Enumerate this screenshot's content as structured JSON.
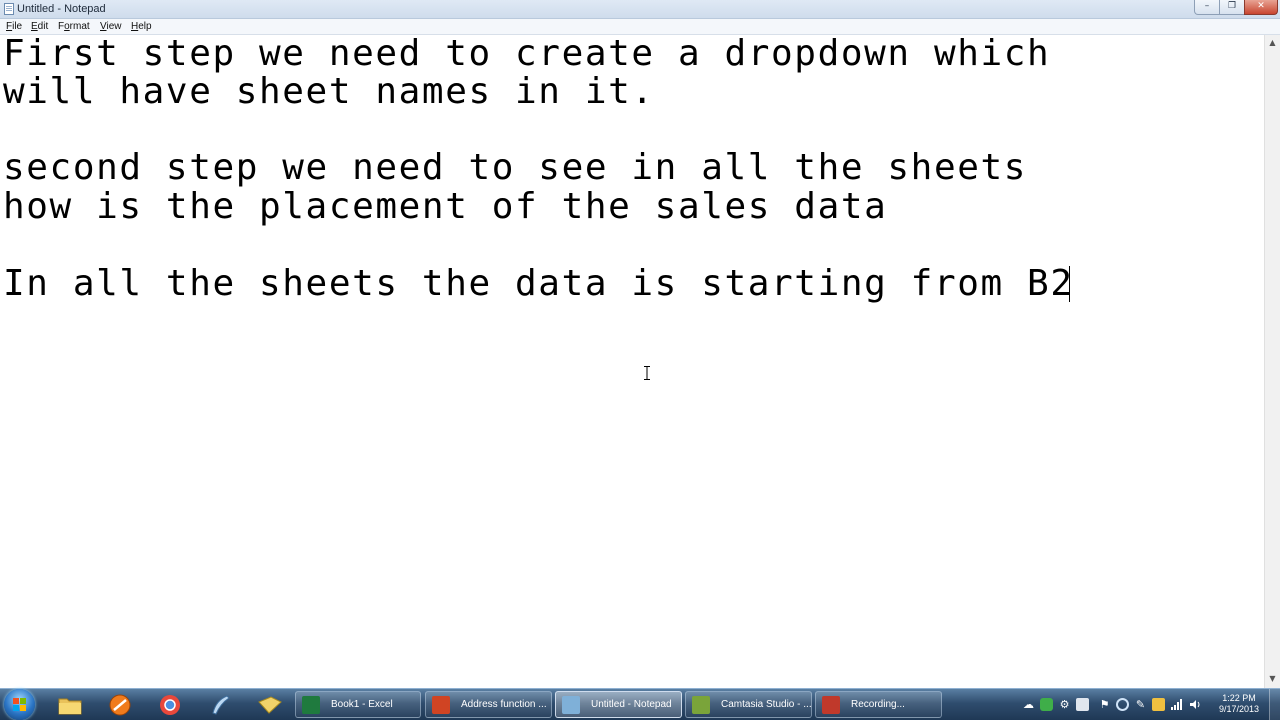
{
  "window": {
    "title": "Untitled - Notepad",
    "controls": {
      "minimize": "–",
      "maximize": "❐",
      "close": "✕"
    }
  },
  "menu": {
    "file": {
      "accel": "F",
      "rest": "ile"
    },
    "edit": {
      "accel": "E",
      "rest": "dit"
    },
    "format": {
      "pre": "F",
      "accel": "o",
      "rest": "rmat"
    },
    "view": {
      "accel": "V",
      "rest": "iew"
    },
    "help": {
      "accel": "H",
      "rest": "elp"
    }
  },
  "editor": {
    "lines": [
      "First step we need to create a dropdown which",
      "will have sheet names in it.",
      "",
      "second step we need to see in all the sheets",
      "how is the placement of the sales data",
      "",
      "In all the sheets the data is starting from B2"
    ]
  },
  "taskbar": {
    "tasks": [
      {
        "label": "Book1 - Excel",
        "icon": "excel-icon",
        "color": "#1f7a3e"
      },
      {
        "label": "Address function ...",
        "icon": "powerpoint-icon",
        "color": "#d04423"
      },
      {
        "label": "Untitled - Notepad",
        "icon": "notepad-icon",
        "color": "#7fb0d8"
      },
      {
        "label": "Camtasia Studio - ...",
        "icon": "camtasia-icon",
        "color": "#7aa43a"
      },
      {
        "label": "Recording...",
        "icon": "recorder-icon",
        "color": "#c0392b"
      }
    ],
    "clock": {
      "time": "1:22 PM",
      "date": "9/17/2013"
    }
  }
}
